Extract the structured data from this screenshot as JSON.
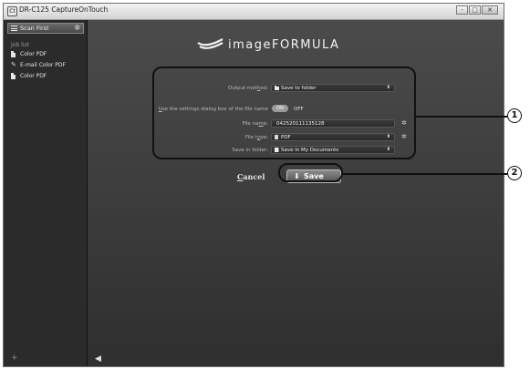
{
  "window": {
    "title": "DR-C125 CaptureOnTouch",
    "app_icon": "Ct",
    "controls": {
      "minimize": "-",
      "maximize": "□",
      "close": "✕"
    }
  },
  "sidebar": {
    "scan_first_label": "Scan First",
    "job_list_label": "Job list",
    "items": [
      {
        "label": "Color PDF",
        "icon": "document-icon"
      },
      {
        "label": "E-mail Color PDF",
        "icon": "email-icon"
      },
      {
        "label": "Color PDF",
        "icon": "document-icon"
      }
    ],
    "add_label": "+"
  },
  "main": {
    "logo_text": "imageFORMULA",
    "output_method": {
      "label_pre": "Output met",
      "label_u": "h",
      "label_post": "od:",
      "value": "Save to folder"
    },
    "settings_dialog": {
      "label_u": "U",
      "label_post": "se the settings dialog box of the file name",
      "on_label": "ON",
      "off_label": "OFF"
    },
    "file_name": {
      "label_pre": "File na",
      "label_u": "m",
      "label_post": "e:",
      "value": "042520111135128"
    },
    "file_type": {
      "label_pre": "File t",
      "label_u": "y",
      "label_post": "pe:",
      "value": "PDF"
    },
    "save_in_folder": {
      "label": "Save in folder:",
      "value": "Save in My Documents"
    },
    "cancel_label_u": "C",
    "cancel_label_post": "ancel",
    "save_label": "Save",
    "back_arrow": "🡄"
  },
  "callouts": {
    "one": "1",
    "two": "2"
  },
  "colors": {
    "panel": "#3e3e3e",
    "sidebar": "#2b2b2b",
    "callout": "#111111"
  }
}
